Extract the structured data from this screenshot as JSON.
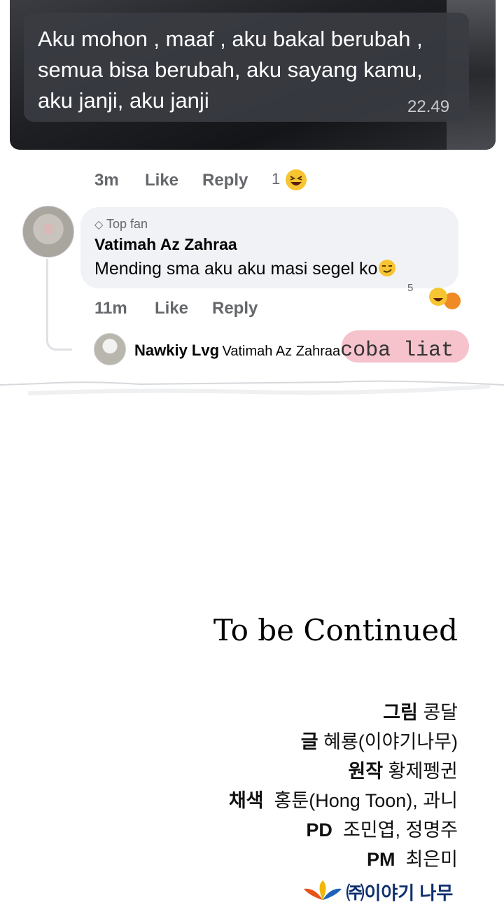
{
  "chat": {
    "message": "Aku mohon , maaf  , aku bakal berubah , semua bisa berubah, aku sayang kamu, aku janji, aku janji",
    "time": "22.49"
  },
  "first_comment_meta": {
    "time": "3m",
    "like_label": "Like",
    "reply_label": "Reply",
    "reaction_count": "1",
    "reaction_icon": "laughing-emoji-icon"
  },
  "comment": {
    "badge_icon": "diamond-icon",
    "badge_label": "Top fan",
    "author": "Vatimah Az Zahraa",
    "text": "Mending sma aku aku masi segel ko",
    "text_emoji": "smirk-emoji-icon",
    "reaction_count": "5",
    "time": "11m",
    "like_label": "Like",
    "reply_label": "Reply"
  },
  "reply": {
    "author": "Nawkiy Lvg",
    "mention": "Vatimah Az Zahraa",
    "text": "coba liat"
  },
  "credits": {
    "title": "To be Continued",
    "lines": [
      {
        "role": "그림",
        "name": "콩달"
      },
      {
        "role": "글",
        "name": "혜룡(이야기나무)"
      },
      {
        "role": "원작",
        "name": "황제펭귄"
      },
      {
        "role": "채색",
        "name": "홍툰(Hong Toon), 과니"
      },
      {
        "role": "PD",
        "name": "조민엽, 정명주"
      },
      {
        "role": "PM",
        "name": "최은미"
      }
    ],
    "publisher": "㈜이야기 나무"
  },
  "colors": {
    "meta_gray": "#65676b",
    "bubble_gray": "#f0f2f5",
    "highlight_pink": "#f4b9c4",
    "emoji_yellow": "#f7c531"
  }
}
